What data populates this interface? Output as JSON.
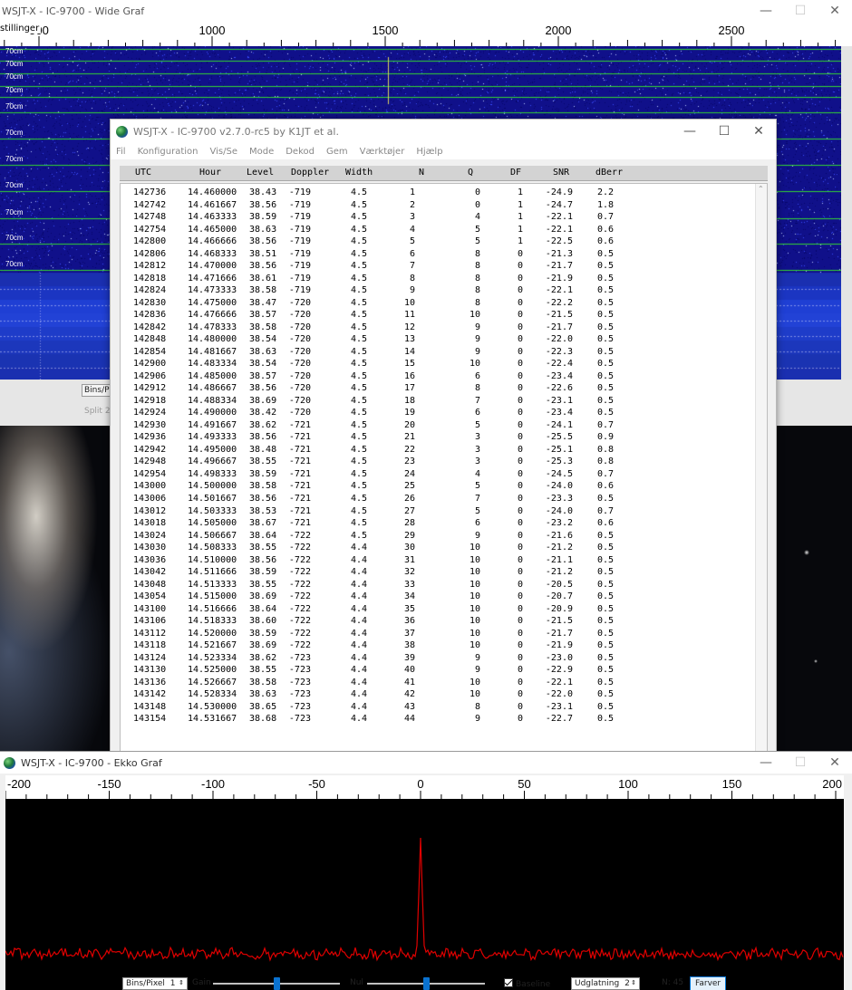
{
  "wide_graph": {
    "title": "WSJT-X - IC-9700 - Wide Graf",
    "scale_label": "stillinger",
    "freq_ticks": [
      "500",
      "1000",
      "1500",
      "2000",
      "2500"
    ],
    "band_labels": [
      "70cm",
      "70cm",
      "70cm",
      "70cm",
      "70cm",
      "70cm",
      "70cm",
      "70cm",
      "70cm",
      "70cm",
      "70cm"
    ],
    "bins_per_pixel_label": "Bins/Pixel",
    "split_label": "Split  2"
  },
  "main_window": {
    "title": "WSJT-X - IC-9700   v2.7.0-rc5   by K1JT et al.",
    "menu": [
      "Fil",
      "Konfiguration",
      "Vis/Se",
      "Mode",
      "Dekod",
      "Gem",
      "Værktøjer",
      "Hjælp"
    ],
    "columns": [
      "UTC",
      "Hour",
      "Level",
      "Doppler",
      "Width",
      "N",
      "Q",
      "DF",
      "SNR",
      "dBerr"
    ],
    "rows": [
      [
        "142736",
        "14.460000",
        "38.43",
        "-719",
        "4.5",
        "1",
        "0",
        "1",
        "-24.9",
        "2.2"
      ],
      [
        "142742",
        "14.461667",
        "38.56",
        "-719",
        "4.5",
        "2",
        "0",
        "1",
        "-24.7",
        "1.8"
      ],
      [
        "142748",
        "14.463333",
        "38.59",
        "-719",
        "4.5",
        "3",
        "4",
        "1",
        "-22.1",
        "0.7"
      ],
      [
        "142754",
        "14.465000",
        "38.63",
        "-719",
        "4.5",
        "4",
        "5",
        "1",
        "-22.1",
        "0.6"
      ],
      [
        "142800",
        "14.466666",
        "38.56",
        "-719",
        "4.5",
        "5",
        "5",
        "1",
        "-22.5",
        "0.6"
      ],
      [
        "142806",
        "14.468333",
        "38.51",
        "-719",
        "4.5",
        "6",
        "8",
        "0",
        "-21.3",
        "0.5"
      ],
      [
        "142812",
        "14.470000",
        "38.56",
        "-719",
        "4.5",
        "7",
        "8",
        "0",
        "-21.7",
        "0.5"
      ],
      [
        "142818",
        "14.471666",
        "38.61",
        "-719",
        "4.5",
        "8",
        "8",
        "0",
        "-21.9",
        "0.5"
      ],
      [
        "142824",
        "14.473333",
        "38.58",
        "-719",
        "4.5",
        "9",
        "8",
        "0",
        "-22.1",
        "0.5"
      ],
      [
        "142830",
        "14.475000",
        "38.47",
        "-720",
        "4.5",
        "10",
        "8",
        "0",
        "-22.2",
        "0.5"
      ],
      [
        "142836",
        "14.476666",
        "38.57",
        "-720",
        "4.5",
        "11",
        "10",
        "0",
        "-21.5",
        "0.5"
      ],
      [
        "142842",
        "14.478333",
        "38.58",
        "-720",
        "4.5",
        "12",
        "9",
        "0",
        "-21.7",
        "0.5"
      ],
      [
        "142848",
        "14.480000",
        "38.54",
        "-720",
        "4.5",
        "13",
        "9",
        "0",
        "-22.0",
        "0.5"
      ],
      [
        "142854",
        "14.481667",
        "38.63",
        "-720",
        "4.5",
        "14",
        "9",
        "0",
        "-22.3",
        "0.5"
      ],
      [
        "142900",
        "14.483334",
        "38.54",
        "-720",
        "4.5",
        "15",
        "10",
        "0",
        "-22.4",
        "0.5"
      ],
      [
        "142906",
        "14.485000",
        "38.57",
        "-720",
        "4.5",
        "16",
        "6",
        "0",
        "-23.4",
        "0.5"
      ],
      [
        "142912",
        "14.486667",
        "38.56",
        "-720",
        "4.5",
        "17",
        "8",
        "0",
        "-22.6",
        "0.5"
      ],
      [
        "142918",
        "14.488334",
        "38.69",
        "-720",
        "4.5",
        "18",
        "7",
        "0",
        "-23.1",
        "0.5"
      ],
      [
        "142924",
        "14.490000",
        "38.42",
        "-720",
        "4.5",
        "19",
        "6",
        "0",
        "-23.4",
        "0.5"
      ],
      [
        "142930",
        "14.491667",
        "38.62",
        "-721",
        "4.5",
        "20",
        "5",
        "0",
        "-24.1",
        "0.7"
      ],
      [
        "142936",
        "14.493333",
        "38.56",
        "-721",
        "4.5",
        "21",
        "3",
        "0",
        "-25.5",
        "0.9"
      ],
      [
        "142942",
        "14.495000",
        "38.48",
        "-721",
        "4.5",
        "22",
        "3",
        "0",
        "-25.1",
        "0.8"
      ],
      [
        "142948",
        "14.496667",
        "38.55",
        "-721",
        "4.5",
        "23",
        "3",
        "0",
        "-25.3",
        "0.8"
      ],
      [
        "142954",
        "14.498333",
        "38.59",
        "-721",
        "4.5",
        "24",
        "4",
        "0",
        "-24.5",
        "0.7"
      ],
      [
        "143000",
        "14.500000",
        "38.58",
        "-721",
        "4.5",
        "25",
        "5",
        "0",
        "-24.0",
        "0.6"
      ],
      [
        "143006",
        "14.501667",
        "38.56",
        "-721",
        "4.5",
        "26",
        "7",
        "0",
        "-23.3",
        "0.5"
      ],
      [
        "143012",
        "14.503333",
        "38.53",
        "-721",
        "4.5",
        "27",
        "5",
        "0",
        "-24.0",
        "0.7"
      ],
      [
        "143018",
        "14.505000",
        "38.67",
        "-721",
        "4.5",
        "28",
        "6",
        "0",
        "-23.2",
        "0.6"
      ],
      [
        "143024",
        "14.506667",
        "38.64",
        "-722",
        "4.5",
        "29",
        "9",
        "0",
        "-21.6",
        "0.5"
      ],
      [
        "143030",
        "14.508333",
        "38.55",
        "-722",
        "4.4",
        "30",
        "10",
        "0",
        "-21.2",
        "0.5"
      ],
      [
        "143036",
        "14.510000",
        "38.56",
        "-722",
        "4.4",
        "31",
        "10",
        "0",
        "-21.1",
        "0.5"
      ],
      [
        "143042",
        "14.511666",
        "38.59",
        "-722",
        "4.4",
        "32",
        "10",
        "0",
        "-21.2",
        "0.5"
      ],
      [
        "143048",
        "14.513333",
        "38.55",
        "-722",
        "4.4",
        "33",
        "10",
        "0",
        "-20.5",
        "0.5"
      ],
      [
        "143054",
        "14.515000",
        "38.69",
        "-722",
        "4.4",
        "34",
        "10",
        "0",
        "-20.7",
        "0.5"
      ],
      [
        "143100",
        "14.516666",
        "38.64",
        "-722",
        "4.4",
        "35",
        "10",
        "0",
        "-20.9",
        "0.5"
      ],
      [
        "143106",
        "14.518333",
        "38.60",
        "-722",
        "4.4",
        "36",
        "10",
        "0",
        "-21.5",
        "0.5"
      ],
      [
        "143112",
        "14.520000",
        "38.59",
        "-722",
        "4.4",
        "37",
        "10",
        "0",
        "-21.7",
        "0.5"
      ],
      [
        "143118",
        "14.521667",
        "38.69",
        "-722",
        "4.4",
        "38",
        "10",
        "0",
        "-21.9",
        "0.5"
      ],
      [
        "143124",
        "14.523334",
        "38.62",
        "-723",
        "4.4",
        "39",
        "9",
        "0",
        "-23.0",
        "0.5"
      ],
      [
        "143130",
        "14.525000",
        "38.55",
        "-723",
        "4.4",
        "40",
        "9",
        "0",
        "-22.9",
        "0.5"
      ],
      [
        "143136",
        "14.526667",
        "38.58",
        "-723",
        "4.4",
        "41",
        "10",
        "0",
        "-22.1",
        "0.5"
      ],
      [
        "143142",
        "14.528334",
        "38.63",
        "-723",
        "4.4",
        "42",
        "10",
        "0",
        "-22.0",
        "0.5"
      ],
      [
        "143148",
        "14.530000",
        "38.65",
        "-723",
        "4.4",
        "43",
        "8",
        "0",
        "-23.1",
        "0.5"
      ],
      [
        "143154",
        "14.531667",
        "38.68",
        "-723",
        "4.4",
        "44",
        "9",
        "0",
        "-22.7",
        "0.5"
      ]
    ]
  },
  "echo_graph": {
    "title": "WSJT-X - IC-9700 - Ekko Graf",
    "freq_ticks": [
      "-200",
      "-150",
      "-100",
      "-50",
      "0",
      "50",
      "100",
      "150",
      "200"
    ],
    "controls": {
      "bins_label": "Bins/Pixel",
      "bins_value": "1",
      "gain_label": "Gain",
      "gain_level": 0.5,
      "nul_label": "Nul",
      "nul_level": 0.5,
      "baseline_label": "Baseline",
      "baseline_checked": true,
      "smoothing_label": "Udglatning",
      "smoothing_value": "2",
      "n_label": "N: 45",
      "colors_button": "Farver"
    }
  },
  "colors": {
    "waterfall_dark": "#00009a",
    "waterfall_band_line": "#33d633",
    "echo_trace": "#e00000"
  }
}
